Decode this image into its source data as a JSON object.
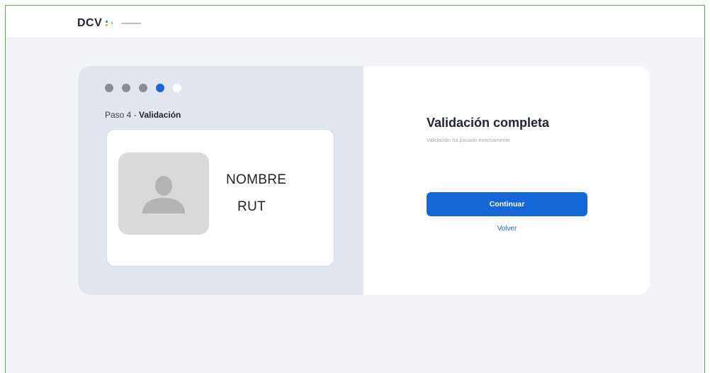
{
  "header": {
    "logo_text": "DCV"
  },
  "stepper": {
    "steps_total": 5,
    "current_step": 4,
    "step_prefix": "Paso 4 - ",
    "step_name": "Validación"
  },
  "identity": {
    "name_placeholder": "NOMBRE",
    "rut_placeholder": "RUT",
    "avatar_icon": "user-icon"
  },
  "result": {
    "title": "Validación completa",
    "subtitle": "Validación ha pasado exitosamente",
    "continue_label": "Continuar",
    "back_label": "Volver"
  },
  "colors": {
    "accent": "#1566d8",
    "step_done": "#858e9b",
    "left_panel_bg": "#e1e6f1",
    "frame_border": "#5aa64a"
  }
}
